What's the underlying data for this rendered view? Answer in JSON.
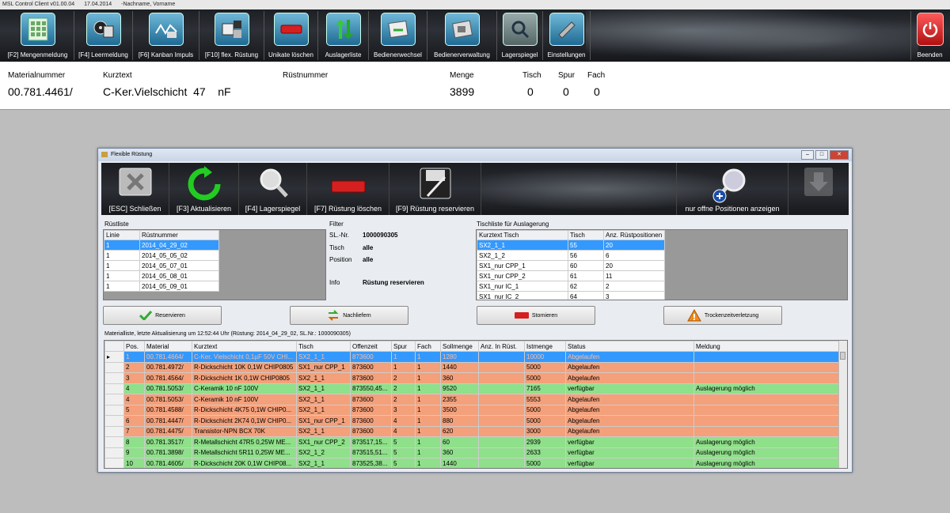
{
  "window": {
    "title_app": "MSL Control Client v01.00.04",
    "title_date": "17.04.2014",
    "title_user": "-Nachname, Vorname"
  },
  "toolbar": {
    "items": [
      {
        "label": "[F2] Mengenmeldung",
        "icon": "grid-icon"
      },
      {
        "label": "[F4] Leermeldung",
        "icon": "reel-icon"
      },
      {
        "label": "[F6] Kanban Impuls",
        "icon": "kanban-icon"
      },
      {
        "label": "[F10] flex. Rüstung",
        "icon": "flex-setup-icon"
      },
      {
        "label": "Unikate löschen",
        "icon": "delete-icon"
      },
      {
        "label": "Auslagerliste",
        "icon": "arrows-icon"
      },
      {
        "label": "Bedienerwechsel",
        "icon": "operator-change-icon"
      },
      {
        "label": "Bedienerverwaltung",
        "icon": "operator-manage-icon"
      },
      {
        "label": "Lagerspiegel",
        "icon": "magnifier-icon"
      },
      {
        "label": "Einstellungen",
        "icon": "settings-icon"
      }
    ],
    "exit_label": "Beenden"
  },
  "header": {
    "material_label": "Materialnummer",
    "material_value": "00.781.4461/",
    "kurztext_label": "Kurztext",
    "kurztext_value": "C-Ker.Vielschicht  47    nF",
    "ruest_label": "Rüstnummer",
    "menge_label": "Menge",
    "menge_value": "3899",
    "tisch_label": "Tisch",
    "tisch_value": "0",
    "spur_label": "Spur",
    "spur_value": "0",
    "fach_label": "Fach",
    "fach_value": "0"
  },
  "dialog": {
    "title": "Flexible Rüstung",
    "toolbar": [
      "[ESC] Schließen",
      "[F3] Aktualisieren",
      "[F4] Lagerspiegel",
      "[F7] Rüstung löschen",
      "[F9] Rüstung reservieren",
      "nur offne Positionen anzeigen"
    ],
    "ruestliste": {
      "label": "Rüstliste",
      "columns": [
        "Linie",
        "Rüstnummer"
      ],
      "rows": [
        [
          "1",
          "2014_04_29_02"
        ],
        [
          "1",
          "2014_05_05_02"
        ],
        [
          "1",
          "2014_05_07_01"
        ],
        [
          "1",
          "2014_05_08_01"
        ],
        [
          "1",
          "2014_05_09_01"
        ]
      ]
    },
    "filter": {
      "label": "Filter",
      "slnr_label": "SL.-Nr.",
      "slnr_value": "1000090305",
      "tisch_label": "Tisch",
      "tisch_value": "alle",
      "position_label": "Position",
      "position_value": "alle",
      "info_label": "Info",
      "info_value": "Rüstung reservieren"
    },
    "tischliste": {
      "label": "Tischliste für Auslagerung",
      "columns": [
        "Kurztext Tisch",
        "Tisch",
        "Anz. Rüstpositionen"
      ],
      "rows": [
        [
          "SX2_1_1",
          "55",
          "20"
        ],
        [
          "SX2_1_2",
          "56",
          "6"
        ],
        [
          "SX1_nur CPP_1",
          "60",
          "20"
        ],
        [
          "SX1_nur CPP_2",
          "61",
          "11"
        ],
        [
          "SX1_nur IC_1",
          "62",
          "2"
        ],
        [
          "SX1_nur IC_2",
          "64",
          "3"
        ]
      ]
    },
    "actions": {
      "reserve": "Reservieren",
      "redeliver": "Nachliefern",
      "cancel": "Stornieren",
      "dry": "Trockenzeitverletzung"
    },
    "info_line": "Materialliste, letzte Aktualisierung um 12:52:44 Uhr  (Rüstung: 2014_04_29_02, SL.Nr.: 1000090305)",
    "material_table": {
      "columns": [
        "Pos.",
        "Material",
        "Kurztext",
        "Tisch",
        "Offenzeit",
        "Spur",
        "Fach",
        "Sollmenge",
        "Anz. In Rüst.",
        "Istmenge",
        "Status",
        "Meldung"
      ],
      "rows": [
        {
          "status_color": "sel",
          "cells": [
            "1",
            "00.781.4664/",
            "C-Ker. Vielschicht 0,1µF 50V CHI...",
            "SX2_1_1",
            "873600",
            "1",
            "1",
            "1280",
            "",
            "10000",
            "Abgelaufen",
            ""
          ]
        },
        {
          "status_color": "red",
          "cells": [
            "2",
            "00.781.4972/",
            "R-Dickschicht 10K 0,1W CHIP0805",
            "SX1_nur CPP_1",
            "873600",
            "1",
            "1",
            "1440",
            "",
            "5000",
            "Abgelaufen",
            ""
          ]
        },
        {
          "status_color": "red",
          "cells": [
            "3",
            "00.781.4564/",
            "R-Dickschicht 1K 0,1W CHIP0805",
            "SX2_1_1",
            "873600",
            "2",
            "1",
            "360",
            "",
            "5000",
            "Abgelaufen",
            ""
          ]
        },
        {
          "status_color": "green",
          "cells": [
            "4",
            "00.781.5053/",
            "C-Keramik  10    nF  100V",
            "SX2_1_1",
            "873550,45...",
            "2",
            "1",
            "9520",
            "",
            "7165",
            "verfügbar",
            "Auslagerung möglich"
          ]
        },
        {
          "status_color": "red",
          "cells": [
            "4",
            "00.781.5053/",
            "C-Keramik  10    nF  100V",
            "SX2_1_1",
            "873600",
            "2",
            "1",
            "2355",
            "",
            "5553",
            "Abgelaufen",
            ""
          ]
        },
        {
          "status_color": "red",
          "cells": [
            "5",
            "00.781.4588/",
            "R-Dickschicht 4K75 0,1W CHIP0...",
            "SX2_1_1",
            "873600",
            "3",
            "1",
            "3500",
            "",
            "5000",
            "Abgelaufen",
            ""
          ]
        },
        {
          "status_color": "red",
          "cells": [
            "6",
            "00.781.4447/",
            "R-Dickschicht 2K74 0,1W CHIP0...",
            "SX1_nur CPP_1",
            "873600",
            "4",
            "1",
            "880",
            "",
            "5000",
            "Abgelaufen",
            ""
          ]
        },
        {
          "status_color": "red",
          "cells": [
            "7",
            "00.781.4475/",
            "Transistor-NPN BCX 70K",
            "SX2_1_1",
            "873600",
            "4",
            "1",
            "620",
            "",
            "3000",
            "Abgelaufen",
            ""
          ]
        },
        {
          "status_color": "green",
          "cells": [
            "8",
            "00.781.3517/",
            "R-Metallschicht 47R5 0,25W ME...",
            "SX1_nur CPP_2",
            "873517,15...",
            "5",
            "1",
            "60",
            "",
            "2939",
            "verfügbar",
            "Auslagerung möglich"
          ]
        },
        {
          "status_color": "green",
          "cells": [
            "9",
            "00.781.3898/",
            "R-Metallschicht 5R11 0,25W ME...",
            "SX2_1_2",
            "873515,51...",
            "5",
            "1",
            "360",
            "",
            "2633",
            "verfügbar",
            "Auslagerung möglich"
          ]
        },
        {
          "status_color": "green",
          "cells": [
            "10",
            "00.781.4605/",
            "R-Dickschicht 20K 0,1W CHIP08...",
            "SX2_1_1",
            "873525,38...",
            "5",
            "1",
            "1440",
            "",
            "5000",
            "verfügbar",
            "Auslagerung möglich"
          ]
        }
      ]
    }
  },
  "colors": {
    "red_row": "#f4a07a",
    "green_row": "#8fe08a",
    "selected_row": "#3399ff"
  }
}
